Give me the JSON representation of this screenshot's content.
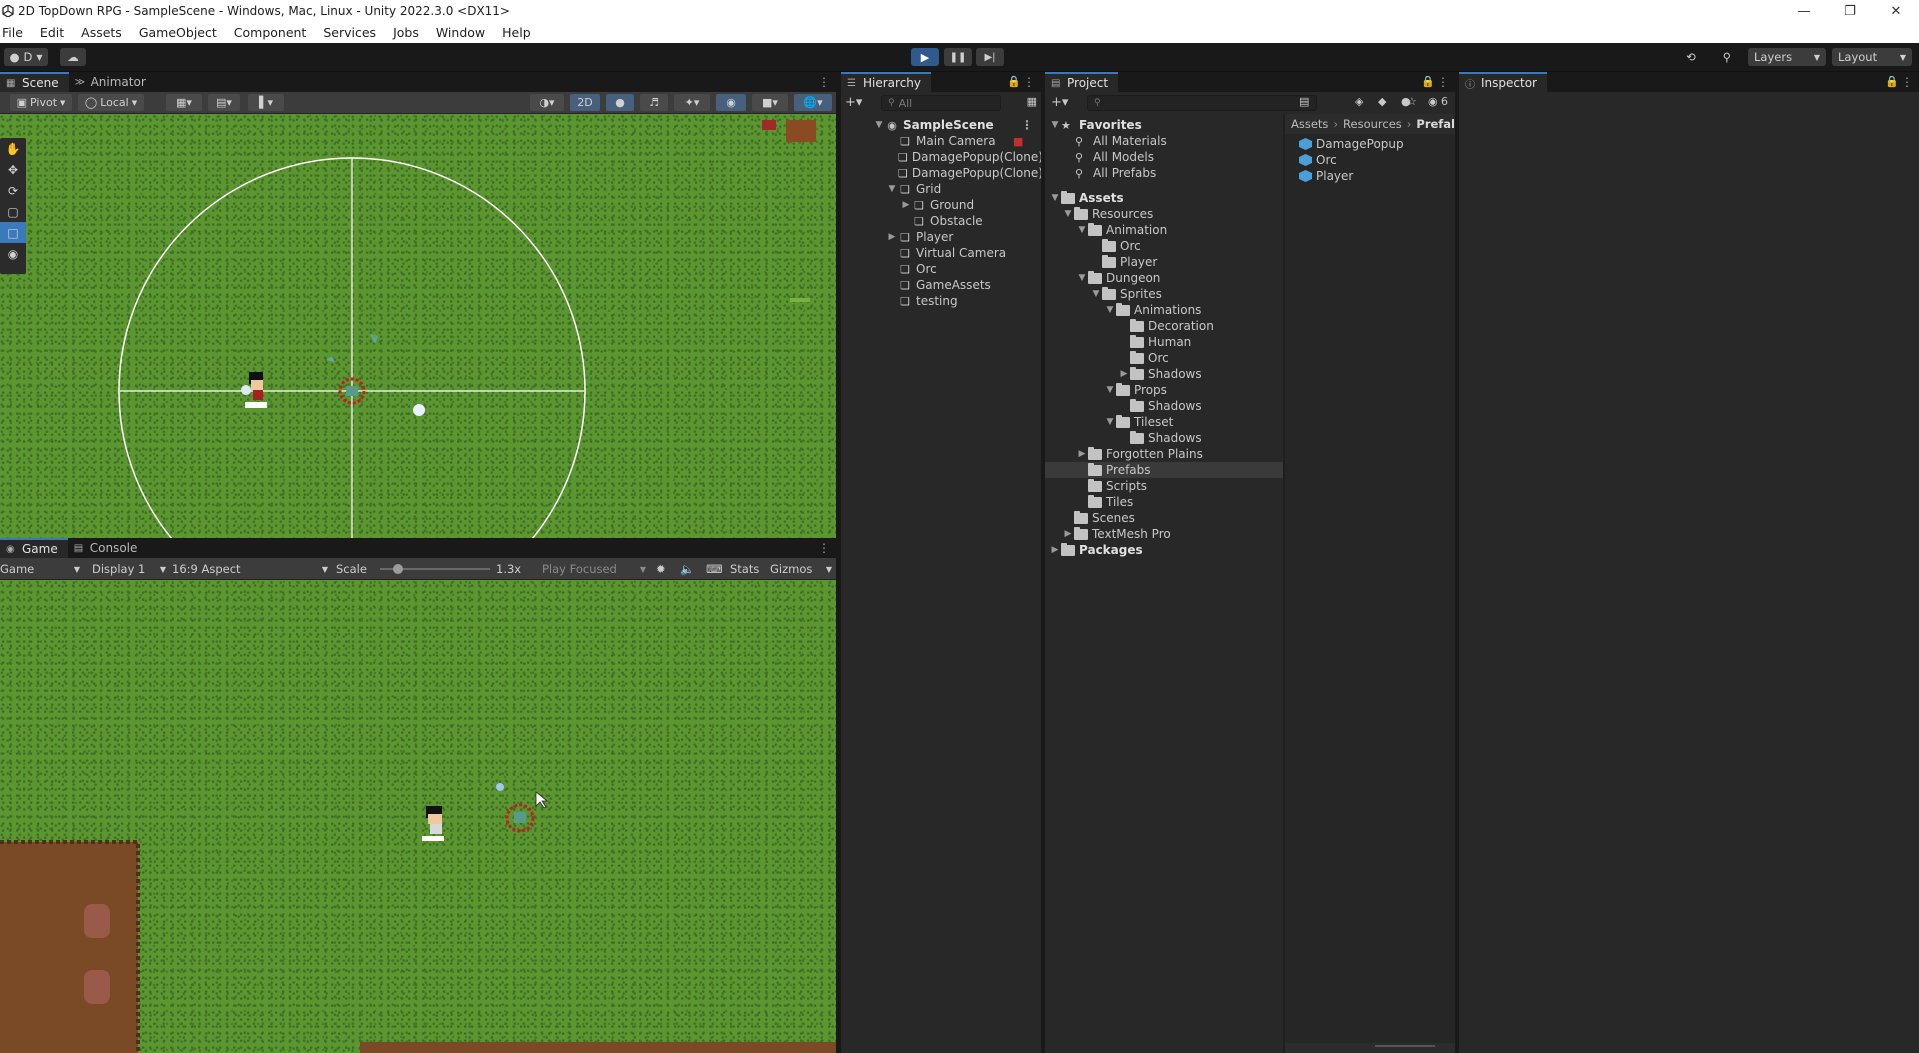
{
  "window": {
    "title": "2D TopDown RPG - SampleScene - Windows, Mac, Linux - Unity 2022.3.0 <DX11>"
  },
  "menu": [
    "File",
    "Edit",
    "Assets",
    "GameObject",
    "Component",
    "Services",
    "Jobs",
    "Window",
    "Help"
  ],
  "toolbar": {
    "account": "D",
    "layers": "Layers",
    "layout": "Layout"
  },
  "scene": {
    "tabs": [
      "Scene",
      "Animator"
    ],
    "pivot": "Pivot",
    "local": "Local",
    "mode2d": "2D"
  },
  "game": {
    "tabs": [
      "Game",
      "Console"
    ],
    "mode": "Game",
    "display": "Display 1",
    "aspect": "16:9 Aspect",
    "scale_label": "Scale",
    "scale_value": "1.3x",
    "play_focused": "Play Focused",
    "stats": "Stats",
    "gizmos": "Gizmos"
  },
  "hierarchy": {
    "tab": "Hierarchy",
    "search_placeholder": "All",
    "scene": "SampleScene",
    "items": [
      {
        "label": "Main Camera"
      },
      {
        "label": "DamagePopup(Clone)"
      },
      {
        "label": "DamagePopup(Clone)"
      },
      {
        "label": "Grid"
      },
      {
        "label": "Ground"
      },
      {
        "label": "Obstacle"
      },
      {
        "label": "Player"
      },
      {
        "label": "Virtual Camera"
      },
      {
        "label": "Orc"
      },
      {
        "label": "GameAssets"
      },
      {
        "label": "testing"
      }
    ]
  },
  "project": {
    "tab": "Project",
    "hidden_count": "6",
    "favorites": {
      "title": "Favorites",
      "items": [
        "All Materials",
        "All Models",
        "All Prefabs"
      ]
    },
    "assets_root": "Assets",
    "folders": [
      "Resources",
      "Animation",
      "Orc",
      "Player",
      "Dungeon",
      "Sprites",
      "Animations",
      "Decoration",
      "Human",
      "Orc",
      "Shadows",
      "Props",
      "Shadows",
      "Tileset",
      "Shadows",
      "Forgotten Plains",
      "Prefabs",
      "Scripts",
      "Tiles",
      "Scenes",
      "TextMesh Pro"
    ],
    "packages": "Packages",
    "breadcrumb": [
      "Assets",
      "Resources",
      "Prefal"
    ],
    "prefabs": [
      "DamagePopup",
      "Orc",
      "Player"
    ]
  },
  "inspector": {
    "tab": "Inspector"
  },
  "colors": {
    "accent": "#3a79bb",
    "grass": "#5c9630",
    "dirt": "#7a4a26"
  }
}
